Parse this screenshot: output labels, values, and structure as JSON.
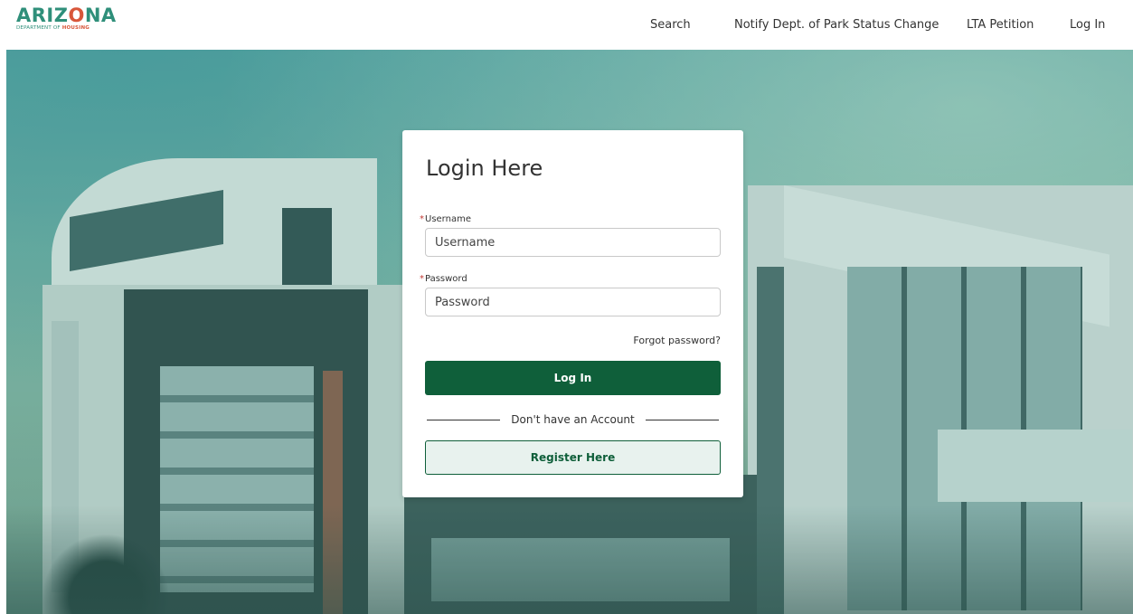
{
  "header": {
    "logo": {
      "main_prefix": "ARIZ",
      "main_accent": "O",
      "main_suffix": "NA",
      "sub_prefix": "DEPARTMENT OF ",
      "sub_strong": "HOUSING"
    },
    "nav": [
      {
        "label": "Search"
      },
      {
        "label": "Notify Dept. of Park Status Change"
      },
      {
        "label": "LTA Petition"
      },
      {
        "label": "Log In"
      }
    ]
  },
  "login": {
    "title": "Login Here",
    "username": {
      "label": "Username",
      "required_mark": "*",
      "placeholder": "Username",
      "value": ""
    },
    "password": {
      "label": "Password",
      "required_mark": "*",
      "placeholder": "Password",
      "value": ""
    },
    "forgot_label": "Forgot password?",
    "login_button": "Log In",
    "divider_text": "Don't have an Account",
    "register_button": "Register Here"
  },
  "colors": {
    "brand_green": "#0f5f3a",
    "logo_teal": "#2f8f7a",
    "logo_accent": "#d8563a",
    "required": "#c23934"
  },
  "icons": {}
}
